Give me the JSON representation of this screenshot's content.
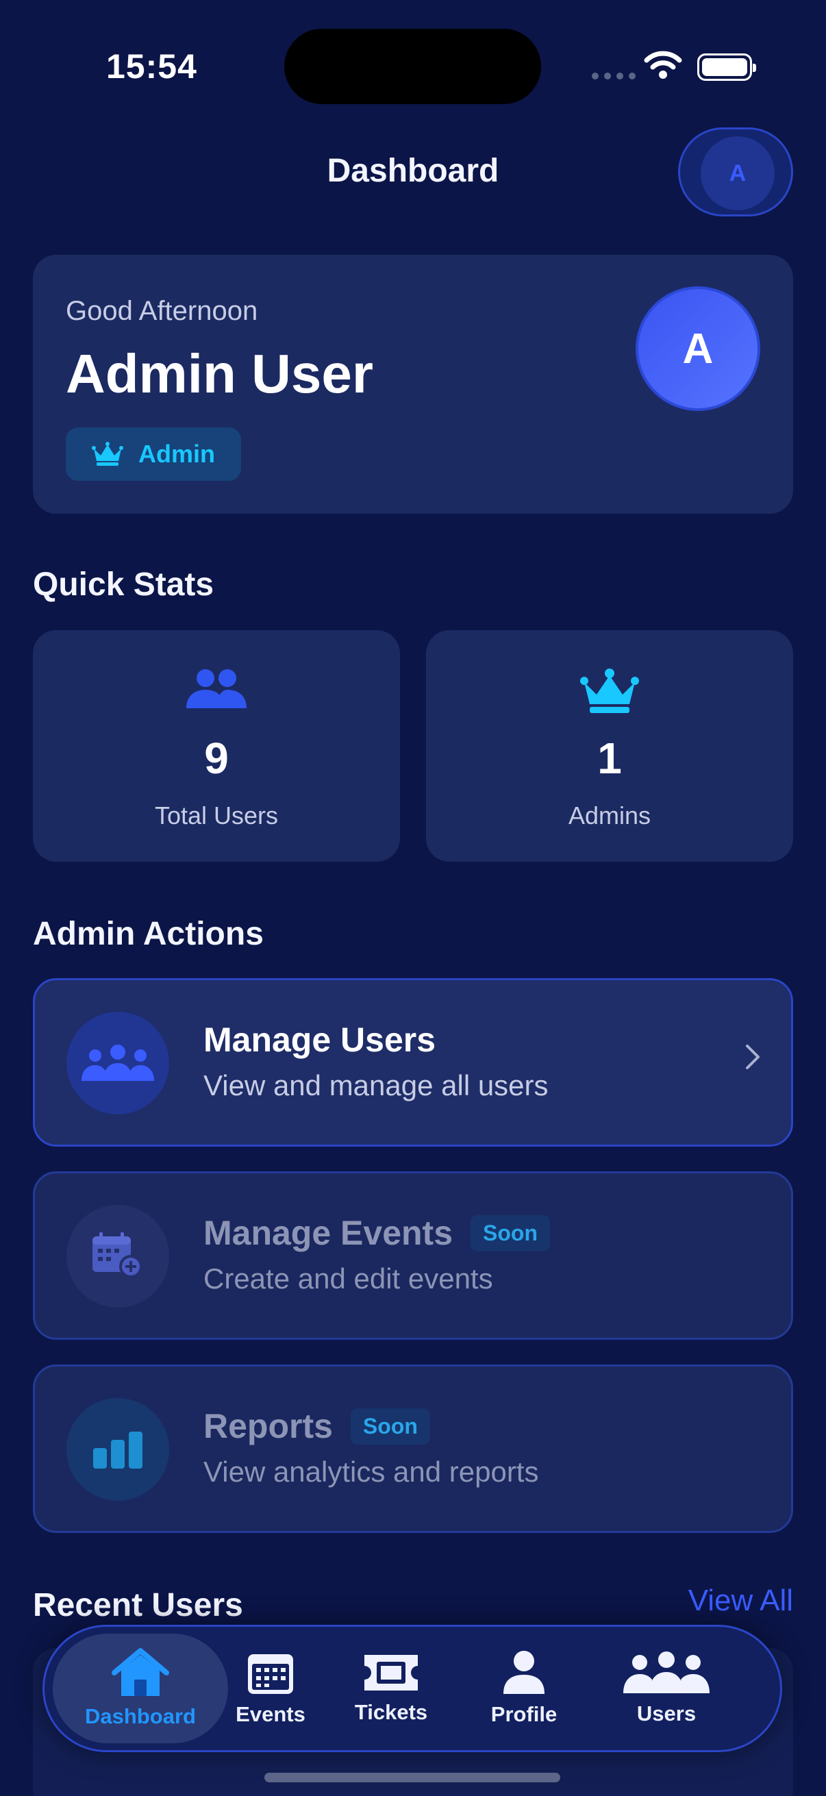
{
  "status": {
    "time": "15:54"
  },
  "header": {
    "title": "Dashboard",
    "avatar_initial": "A"
  },
  "welcome": {
    "greeting": "Good Afternoon",
    "name": "Admin User",
    "role": "Admin",
    "avatar_initial": "A"
  },
  "quick_stats": {
    "title": "Quick Stats",
    "items": [
      {
        "value": "9",
        "label": "Total Users",
        "icon": "users-icon"
      },
      {
        "value": "1",
        "label": "Admins",
        "icon": "crown-icon"
      }
    ]
  },
  "admin_actions": {
    "title": "Admin Actions",
    "items": [
      {
        "title": "Manage Users",
        "subtitle": "View and manage all users",
        "icon": "group-icon"
      },
      {
        "title": "Manage Events",
        "subtitle": "Create and edit events",
        "badge": "Soon",
        "icon": "calendar-add-icon"
      },
      {
        "title": "Reports",
        "subtitle": "View analytics and reports",
        "badge": "Soon",
        "icon": "bar-chart-icon"
      }
    ]
  },
  "recent_users": {
    "title": "Recent Users",
    "view_all": "View All"
  },
  "tabbar": {
    "items": [
      {
        "label": "Dashboard",
        "icon": "home-icon",
        "active": true
      },
      {
        "label": "Events",
        "icon": "calendar-icon"
      },
      {
        "label": "Tickets",
        "icon": "ticket-icon"
      },
      {
        "label": "Profile",
        "icon": "person-icon"
      },
      {
        "label": "Users",
        "icon": "users-icon"
      }
    ]
  },
  "colors": {
    "background": "#0b1547",
    "card": "#1c2a62",
    "accent": "#3b5cff",
    "cyan": "#18c8ff"
  }
}
